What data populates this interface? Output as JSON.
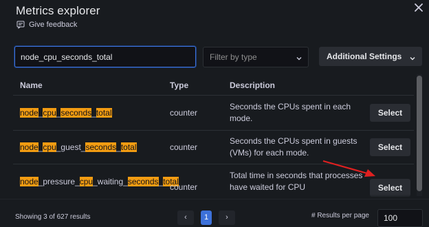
{
  "dialog": {
    "title": "Metrics explorer",
    "feedback_label": "Give feedback"
  },
  "search": {
    "value": "node_cpu_seconds_total"
  },
  "filter": {
    "placeholder": "Filter by type"
  },
  "additional_settings_label": "Additional Settings",
  "table": {
    "columns": [
      "Name",
      "Type",
      "Description"
    ],
    "rows": [
      {
        "name_parts": [
          {
            "text": "node",
            "hl": true
          },
          {
            "text": "_",
            "hl": false
          },
          {
            "text": "cpu",
            "hl": true
          },
          {
            "text": "_",
            "hl": false
          },
          {
            "text": "seconds",
            "hl": true
          },
          {
            "text": "_",
            "hl": false
          },
          {
            "text": "total",
            "hl": true
          }
        ],
        "type": "counter",
        "description": "Seconds the CPUs spent in each mode.",
        "action": "Select"
      },
      {
        "name_parts": [
          {
            "text": "node",
            "hl": true
          },
          {
            "text": "_",
            "hl": false
          },
          {
            "text": "cpu",
            "hl": true
          },
          {
            "text": "_guest_",
            "hl": false
          },
          {
            "text": "seconds",
            "hl": true
          },
          {
            "text": "_",
            "hl": false
          },
          {
            "text": "total",
            "hl": true
          }
        ],
        "type": "counter",
        "description": "Seconds the CPUs spent in guests (VMs) for each mode.",
        "action": "Select"
      },
      {
        "name_parts": [
          {
            "text": "node",
            "hl": true
          },
          {
            "text": "_pressure_",
            "hl": false
          },
          {
            "text": "cpu",
            "hl": true
          },
          {
            "text": "_waiting_",
            "hl": false
          },
          {
            "text": "seconds",
            "hl": true
          },
          {
            "text": "_",
            "hl": false
          },
          {
            "text": "total",
            "hl": true
          }
        ],
        "type": "counter",
        "description": "Total time in seconds that processes have waited for CPU",
        "action": "Select"
      }
    ]
  },
  "footer": {
    "showing": "Showing 3 of 627 results",
    "page_prev": "‹",
    "page_current": "1",
    "page_next": "›",
    "results_per_page_label": "# Results per page",
    "results_per_page": "100"
  },
  "colors": {
    "highlight": "#f39c12",
    "accent": "#3d71d9",
    "annotation_arrow": "#e02020"
  }
}
